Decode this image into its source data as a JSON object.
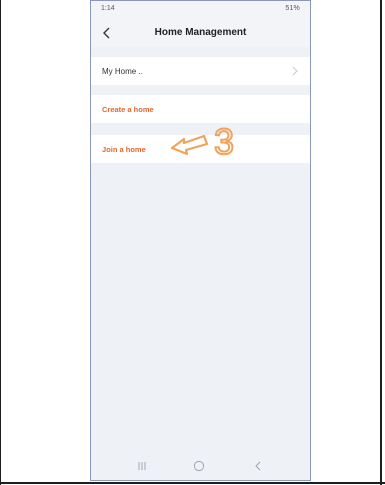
{
  "status_bar": {
    "time": "1:14",
    "indicators": "%`` 51%",
    "battery": "51%"
  },
  "header": {
    "title": "Home Management"
  },
  "homes": [
    {
      "label": "My Home .."
    }
  ],
  "actions": {
    "create": "Create a home",
    "join": "Join a home"
  },
  "annotation": {
    "step": "3",
    "color": "#f0a35b"
  },
  "nav_bar": {
    "items": [
      "recent-apps-icon",
      "home-circle-icon",
      "back-chevron-icon"
    ]
  },
  "colors": {
    "accent": "#e8662b",
    "background": "#eef1f6"
  }
}
